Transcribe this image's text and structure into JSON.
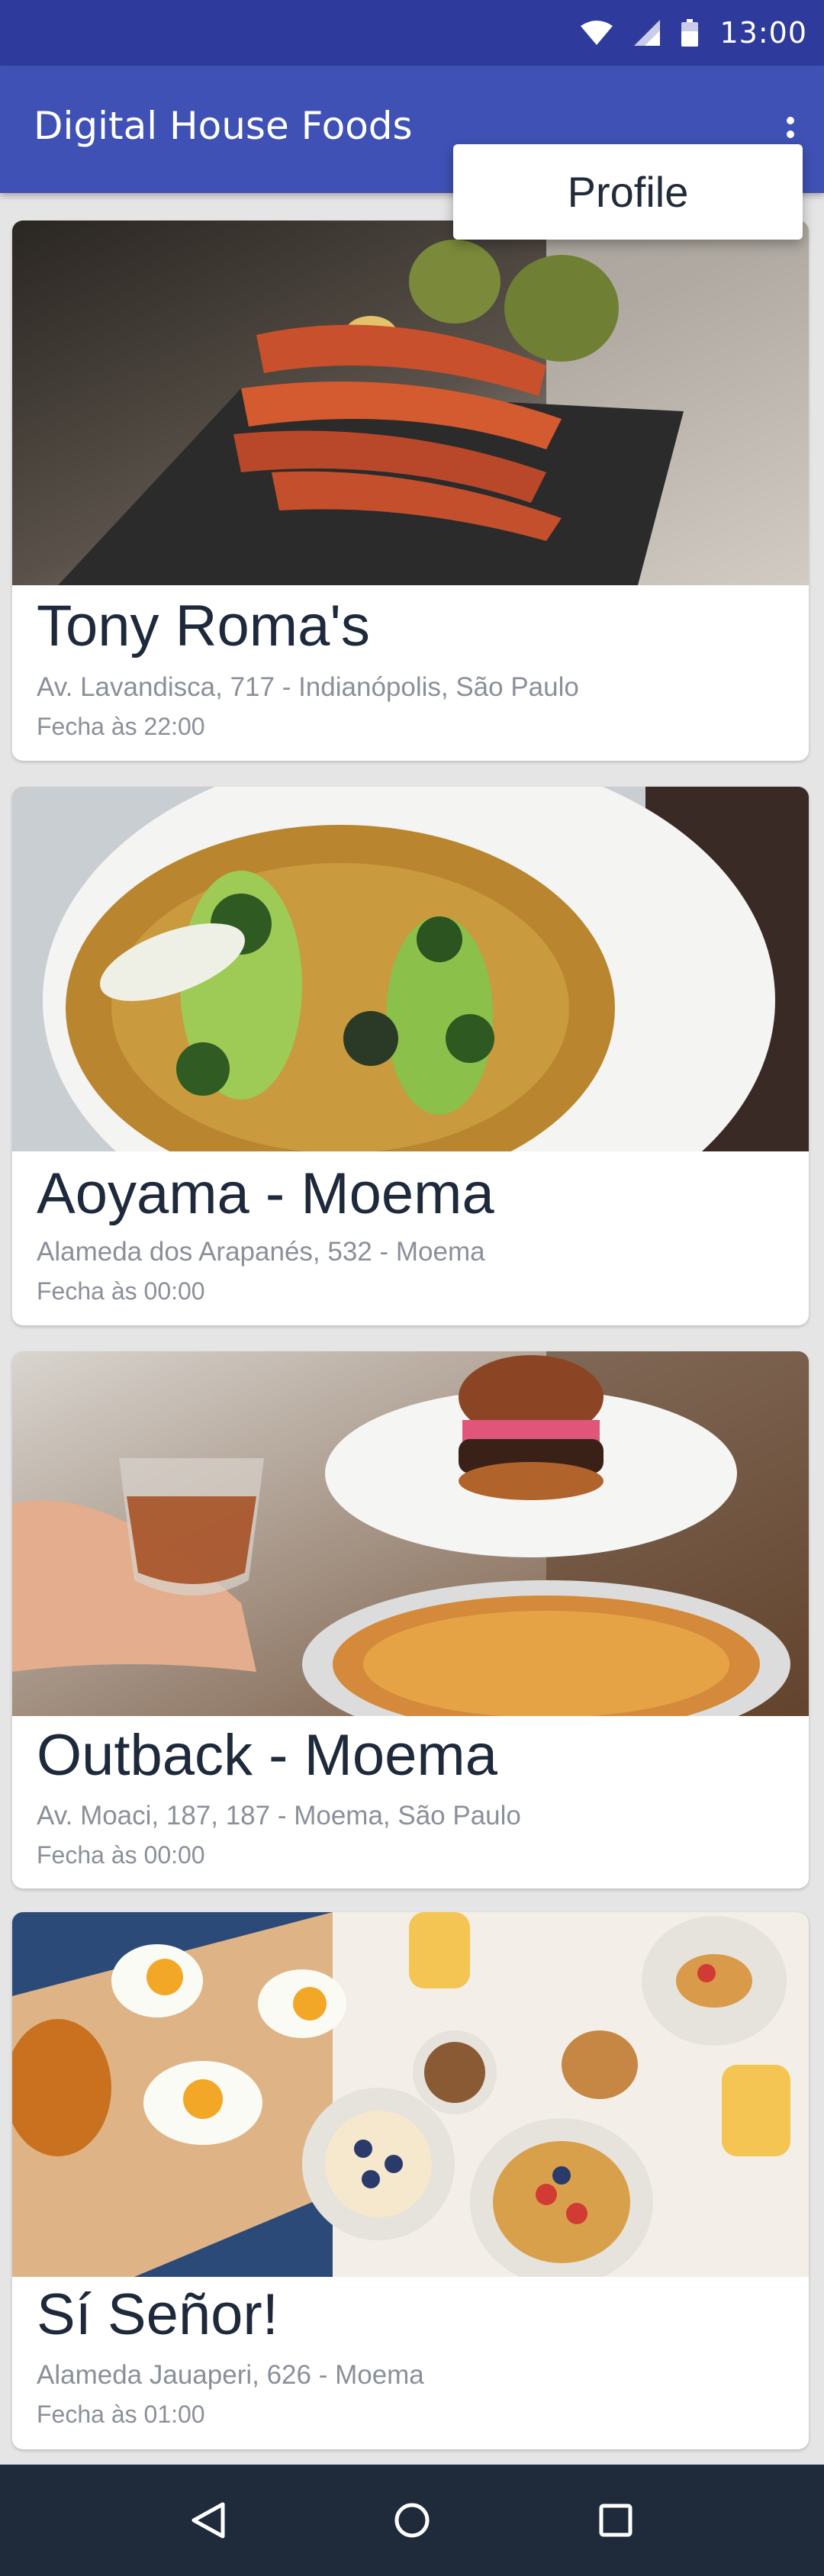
{
  "status_bar": {
    "time": "13:00",
    "icons": [
      "wifi-icon",
      "signal-icon",
      "battery-icon"
    ]
  },
  "app_bar": {
    "title": "Digital House Foods",
    "overflow_icon": "more-vert-icon",
    "background_color": "#3f51b5",
    "status_color": "#2f3b9c"
  },
  "menu": {
    "items": [
      {
        "label": "Profile"
      }
    ]
  },
  "restaurants": [
    {
      "name": "Tony Roma's",
      "address": "Av. Lavandisca, 717 - Indianópolis, São Paulo",
      "hours": "Fecha às 22:00",
      "image": "grilled-shrimp-photo"
    },
    {
      "name": "Aoyama - Moema",
      "address": "Alameda dos Arapanés, 532 - Moema",
      "hours": "Fecha às 00:00",
      "image": "plated-dish-photo"
    },
    {
      "name": "Outback - Moema",
      "address": "Av. Moaci, 187, 187 - Moema, São Paulo",
      "hours": "Fecha às 00:00",
      "image": "burger-and-drink-photo"
    },
    {
      "name": "Sí Señor!",
      "address": "Alameda Jauaperi, 626 - Moema",
      "hours": "Fecha às 01:00",
      "image": "breakfast-table-photo"
    }
  ],
  "nav_bar": {
    "buttons": [
      "back-icon",
      "home-icon",
      "recents-icon"
    ],
    "background_color": "#1f2a3b"
  }
}
